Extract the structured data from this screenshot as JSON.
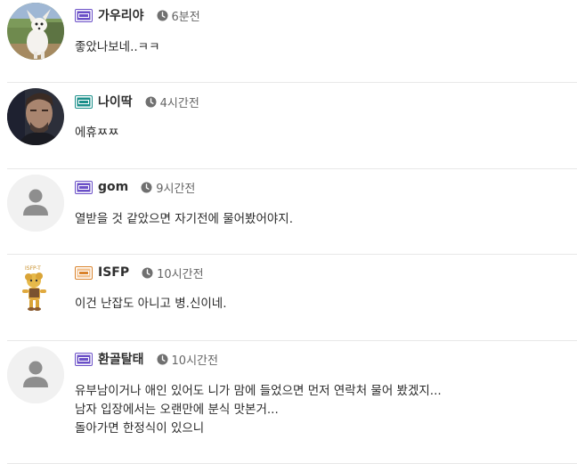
{
  "comments": [
    {
      "nickname": "가우리야",
      "time": "6분전",
      "level_icon": "level-badge-purple",
      "avatar": "chihuahua-photo",
      "lines": [
        "좋았나보네..ㅋㅋ"
      ]
    },
    {
      "nickname": "나이딱",
      "time": "4시간전",
      "level_icon": "level-badge-teal",
      "avatar": "man-portrait-photo",
      "lines": [
        "에휴ㅉㅉ"
      ]
    },
    {
      "nickname": "gom",
      "time": "9시간전",
      "level_icon": "level-badge-purple",
      "avatar": "default-user",
      "lines": [
        "열받을 것 같았으면 자기전에 물어봤어야지."
      ]
    },
    {
      "nickname": "ISFP",
      "time": "10시간전",
      "level_icon": "level-badge-orange",
      "avatar": "isfp-character",
      "avatar_caption": "ISFP-T",
      "lines": [
        "이건 난잡도 아니고 병.신이네."
      ]
    },
    {
      "nickname": "환골탈태",
      "time": "10시간전",
      "level_icon": "level-badge-purple",
      "avatar": "default-user",
      "lines": [
        "유부남이거나 애인 있어도 니가 맘에 들었으면 먼저 연락처 물어 봤겠지...",
        "남자 입장에서는 오랜만에 분식 맛본거...",
        "돌아가면 한정식이 있으니"
      ]
    }
  ],
  "colors": {
    "badge_purple": "#6a4fc7",
    "badge_teal": "#1a8f8a",
    "badge_orange": "#d9822b",
    "divider": "#e8e8e8",
    "meta_text": "#666666"
  }
}
